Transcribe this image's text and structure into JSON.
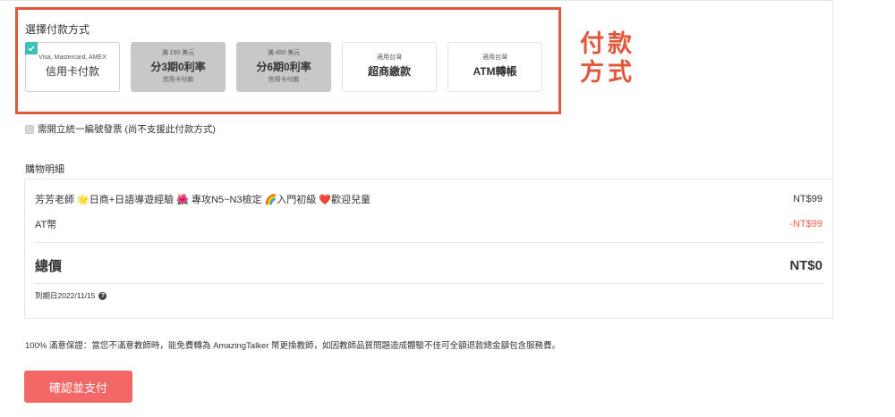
{
  "payment": {
    "section_label": "選擇付款方式",
    "options": [
      {
        "top": "Visa, Mastercard, AMEX",
        "main": "信用卡付款",
        "sub": "",
        "selected": true,
        "disabled": false
      },
      {
        "top": "滿 150 美元",
        "main": "分3期0利率",
        "sub": "信用卡付款",
        "selected": false,
        "disabled": true
      },
      {
        "top": "滿 450 美元",
        "main": "分6期0利率",
        "sub": "信用卡付款",
        "selected": false,
        "disabled": true
      },
      {
        "top": "適用台灣",
        "main": "超商繳款",
        "sub": "",
        "selected": false,
        "disabled": false
      },
      {
        "top": "適用台灣",
        "main": "ATM轉帳",
        "sub": "",
        "selected": false,
        "disabled": false
      }
    ],
    "annotation": "付款方式"
  },
  "invoice": {
    "label": "需開立統一編號發票 (尚不支援此付款方式)",
    "checked": false
  },
  "details": {
    "title": "購物明細",
    "items": [
      {
        "name": "芳芳老師 🌟日商+日語導遊經驗 🌺 專攻N5~N3檢定 🌈入門初級 ❤️歡迎兒童",
        "price": "NT$99",
        "negative": false
      },
      {
        "name": "AT幣",
        "price": "-NT$99",
        "negative": true
      }
    ],
    "total_label": "總價",
    "total_value": "NT$0",
    "expiry": "到期日2022/11/15",
    "help_icon": "question-circle-icon"
  },
  "guarantee": "100% 滿意保證：當您不滿意教師時，能免費轉為 AmazingTalker 幣更換教師，如因教師品質問題造成體驗不佳可全額退款總金額包含服務費。",
  "confirm_button": "確認並支付",
  "colors": {
    "accent_red": "#e0573b",
    "button": "#f36767",
    "check": "#3fc1b4",
    "negative": "#f35b4f"
  }
}
